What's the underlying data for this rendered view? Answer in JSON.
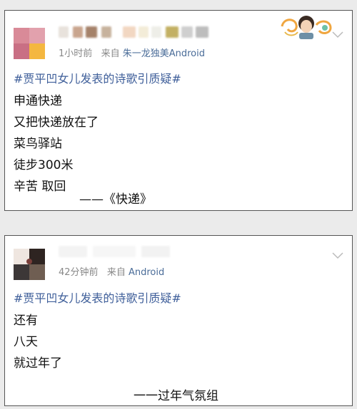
{
  "posts": [
    {
      "meta": {
        "time": "1小时前",
        "from_label": "来自",
        "source": "朱一龙独美Android"
      },
      "hashtag": "#贾平凹女儿发表的诗歌引质疑#",
      "lines": [
        "申通快递",
        "又把快递放在了",
        "菜鸟驿站",
        "徒步300米",
        "辛苦 取回"
      ],
      "signature": "——《快递》"
    },
    {
      "meta": {
        "time": "42分钟前",
        "from_label": "来自",
        "source": "Android"
      },
      "hashtag": "#贾平凹女儿发表的诗歌引质疑#",
      "lines": [
        "还有",
        "八天",
        "就过年了"
      ],
      "signature": "一一过年气氛组"
    }
  ],
  "colors": {
    "hashtag": "#3f5f9a",
    "source": "#4a6c98",
    "meta": "#888888",
    "border": "#555555"
  },
  "icons": [
    "avatar",
    "fan-badge",
    "chevron-down-icon"
  ]
}
